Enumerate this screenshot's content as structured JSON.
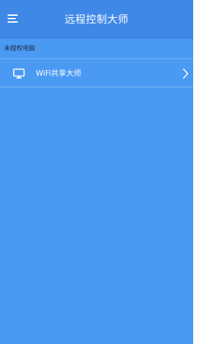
{
  "appbar": {
    "title": "远程控制大师",
    "menu_icon": "menu-icon"
  },
  "section": {
    "header": "未授权电脑"
  },
  "list": {
    "items": [
      {
        "label": "WiFi共享大师",
        "icon": "monitor-icon",
        "trailing_icon": "chevron-right-icon"
      }
    ]
  },
  "colors": {
    "background": "#4a9af3",
    "appbar": "#3f88e8",
    "divider": "#7db6f7",
    "text_light": "#ffffff",
    "text_dark": "#1c2a44"
  }
}
